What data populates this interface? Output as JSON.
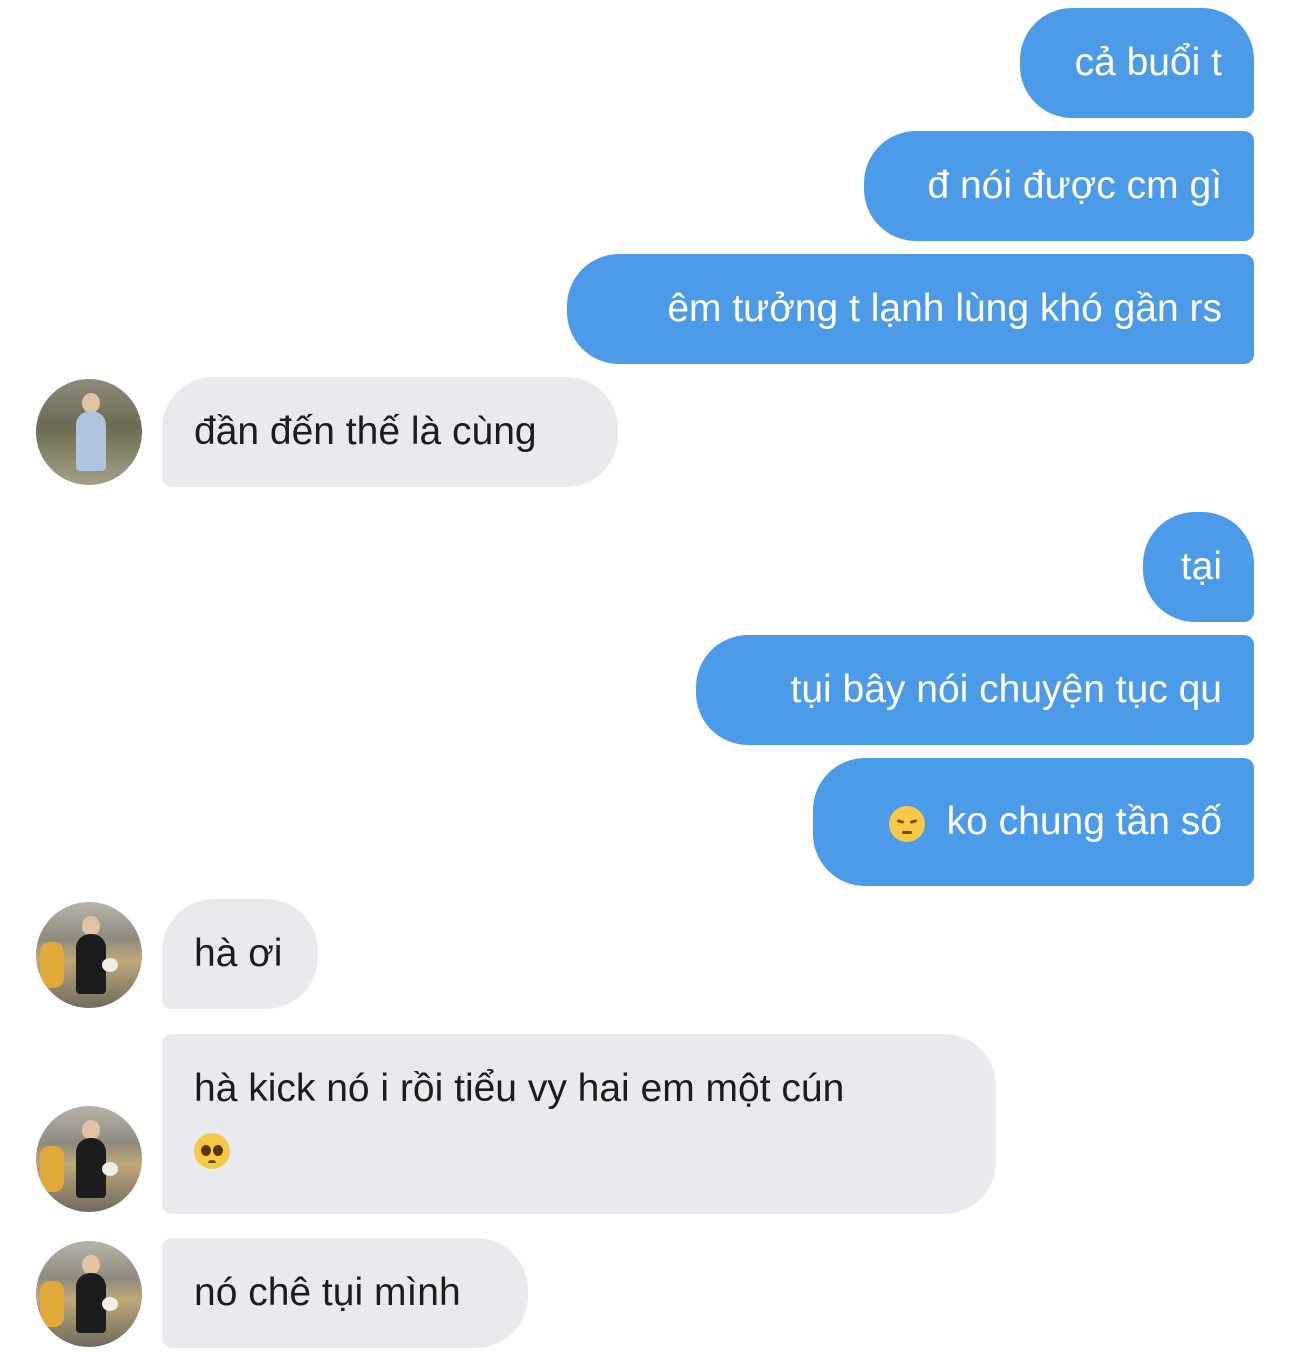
{
  "messages": {
    "m1": "cả buổi t",
    "m2": "đ nói được cm gì",
    "m3": "êm tưởng t lạnh lùng khó gần rs",
    "m4": "đần đến thế là cùng",
    "m5": "tại",
    "m6": "tụi bây nói chuyện tục qu",
    "m7": "ko chung tần số",
    "m8": "hà ơi",
    "m9": "hà kick nó i rồi tiểu vy hai em một cún",
    "m10": "nó chê tụi mình"
  },
  "emojis": {
    "m7": "pensive-face",
    "m9": "pleading-face"
  },
  "colors": {
    "outgoing_bubble": "#4c9be8",
    "incoming_bubble": "#e8eaee",
    "outgoing_text": "#ffffff",
    "incoming_text": "#1c1c1e"
  }
}
